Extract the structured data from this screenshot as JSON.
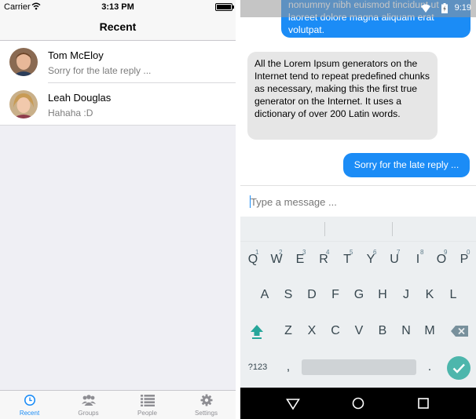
{
  "ios": {
    "status": {
      "carrier": "Carrier",
      "time": "3:13 PM"
    },
    "nav_title": "Recent",
    "conversations": [
      {
        "name": "Tom McEloy",
        "preview": "Sorry for the late reply ..."
      },
      {
        "name": "Leah Douglas",
        "preview": "Hahaha :D"
      }
    ],
    "tabs": [
      {
        "label": "Recent",
        "icon": "clock-icon",
        "active": true
      },
      {
        "label": "Groups",
        "icon": "groups-icon",
        "active": false
      },
      {
        "label": "People",
        "icon": "list-icon",
        "active": false
      },
      {
        "label": "Settings",
        "icon": "gear-icon",
        "active": false
      }
    ]
  },
  "android": {
    "status": {
      "time": "9:19"
    },
    "messages": [
      {
        "direction": "outgoing",
        "text": "nonummy nibh euismod tincidunt ut laoreet dolore magna aliquam erat volutpat."
      },
      {
        "direction": "incoming",
        "text": "All the Lorem Ipsum generators on the Internet tend to repeat predefined chunks as necessary, making this the first true generator on the Internet. It uses a dictionary of over 200 Latin words."
      },
      {
        "direction": "outgoing",
        "text": "Sorry for the late reply ..."
      }
    ],
    "composer": {
      "placeholder": "Type a message ...",
      "value": ""
    },
    "keyboard": {
      "row1": [
        "Q",
        "W",
        "E",
        "R",
        "T",
        "Y",
        "U",
        "I",
        "O",
        "P"
      ],
      "row1_hints": [
        "1",
        "2",
        "3",
        "4",
        "5",
        "6",
        "7",
        "8",
        "9",
        "0"
      ],
      "row2": [
        "A",
        "S",
        "D",
        "F",
        "G",
        "H",
        "J",
        "K",
        "L"
      ],
      "row3": [
        "Z",
        "X",
        "C",
        "V",
        "B",
        "N",
        "M"
      ],
      "symbols_key": "?123",
      "comma": ",",
      "period": "."
    }
  },
  "colors": {
    "accent_blue": "#1b8cf6",
    "incoming_bubble": "#e6e6e6",
    "keyboard_bg": "#eceff1",
    "enter_key": "#4db6ac"
  }
}
